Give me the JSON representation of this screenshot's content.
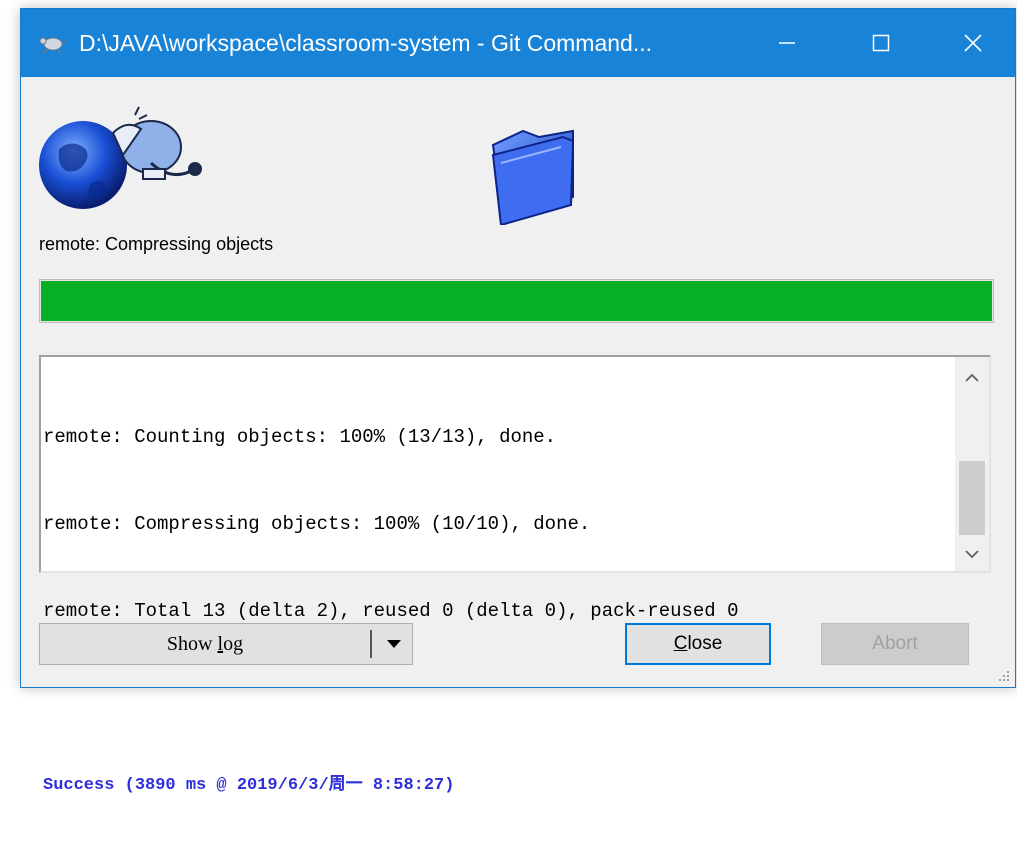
{
  "window": {
    "title": "D:\\JAVA\\workspace\\classroom-system - Git Command...",
    "controls": {
      "minimize_icon": "minimize-icon",
      "maximize_icon": "maximize-icon",
      "close_icon": "close-icon"
    }
  },
  "illustrations": {
    "remote_icon": "globe-network-icon",
    "local_icon": "folder-icon"
  },
  "status": {
    "text": "remote: Compressing objects"
  },
  "progress": {
    "percent": 100,
    "color": "#06b025"
  },
  "log": {
    "lines": [
      "remote: Counting objects: 100% (13/13), done.",
      "remote: Compressing objects: 100% (10/10), done.",
      "remote: Total 13 (delta 2), reused 0 (delta 0), pack-reused 0",
      "",
      "Success (3890 ms @ 2019/6/3/周一 8:58:27)"
    ],
    "success_color": "#2f2fd8",
    "scroll_position": 0.62
  },
  "buttons": {
    "show_log": {
      "label_prefix": "Show ",
      "label_access": "l",
      "label_rest": "og"
    },
    "close": {
      "label_access": "C",
      "label_rest": "lose"
    },
    "abort": {
      "label": "Abort",
      "enabled": false
    }
  },
  "colors": {
    "titlebar": "#1883d7",
    "window_bg": "#f0f0f0"
  }
}
